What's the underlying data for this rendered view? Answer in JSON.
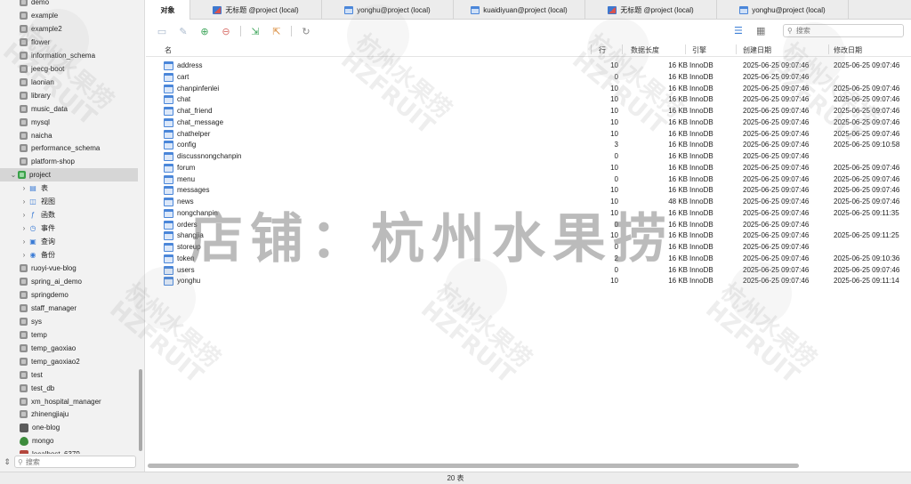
{
  "sidebar": {
    "items": [
      {
        "label": "demo",
        "kind": "db"
      },
      {
        "label": "example",
        "kind": "db"
      },
      {
        "label": "example2",
        "kind": "db"
      },
      {
        "label": "flower",
        "kind": "db"
      },
      {
        "label": "information_schema",
        "kind": "db"
      },
      {
        "label": "jeecg-boot",
        "kind": "db"
      },
      {
        "label": "laonian",
        "kind": "db"
      },
      {
        "label": "library",
        "kind": "db"
      },
      {
        "label": "music_data",
        "kind": "db"
      },
      {
        "label": "mysql",
        "kind": "db"
      },
      {
        "label": "naicha",
        "kind": "db"
      },
      {
        "label": "performance_schema",
        "kind": "db"
      },
      {
        "label": "platform-shop",
        "kind": "db"
      },
      {
        "label": "project",
        "kind": "db-open",
        "selected": true
      },
      {
        "label": "表",
        "kind": "obj",
        "icon": "table-icon"
      },
      {
        "label": "视图",
        "kind": "obj",
        "icon": "view-icon"
      },
      {
        "label": "函数",
        "kind": "obj",
        "icon": "function-icon"
      },
      {
        "label": "事件",
        "kind": "obj",
        "icon": "event-icon"
      },
      {
        "label": "查询",
        "kind": "obj",
        "icon": "query-icon"
      },
      {
        "label": "备份",
        "kind": "obj",
        "icon": "backup-icon"
      },
      {
        "label": "ruoyi-vue-blog",
        "kind": "db"
      },
      {
        "label": "spring_ai_demo",
        "kind": "db"
      },
      {
        "label": "springdemo",
        "kind": "db"
      },
      {
        "label": "staff_manager",
        "kind": "db"
      },
      {
        "label": "sys",
        "kind": "db"
      },
      {
        "label": "temp",
        "kind": "db"
      },
      {
        "label": "temp_gaoxiao",
        "kind": "db"
      },
      {
        "label": "temp_gaoxiao2",
        "kind": "db"
      },
      {
        "label": "test",
        "kind": "db"
      },
      {
        "label": "test_db",
        "kind": "db"
      },
      {
        "label": "xm_hospital_manager",
        "kind": "db"
      },
      {
        "label": "zhinengjiaju",
        "kind": "db"
      },
      {
        "label": "one-blog",
        "kind": "conn",
        "icon": "blog"
      },
      {
        "label": "mongo",
        "kind": "conn",
        "icon": "mongo"
      },
      {
        "label": "localhost_6379",
        "kind": "conn",
        "icon": "redis"
      }
    ],
    "search_placeholder": "搜索"
  },
  "tabs": [
    {
      "label": "对象",
      "active": true,
      "icon": ""
    },
    {
      "label": "无标题 @project (local)",
      "icon": "query"
    },
    {
      "label": "yonghu@project (local)",
      "icon": "table"
    },
    {
      "label": "kuaidiyuan@project (local)",
      "icon": "table"
    },
    {
      "label": "无标题 @project (local)",
      "icon": "query"
    },
    {
      "label": "yonghu@project (local)",
      "icon": "table"
    }
  ],
  "toolbar": {
    "search_placeholder": "搜索"
  },
  "table": {
    "columns": {
      "name": "名",
      "rows": "行",
      "size": "数据长度",
      "engine": "引擎",
      "created": "创建日期",
      "modified": "修改日期"
    },
    "rows": [
      {
        "name": "address",
        "rows": "10",
        "size": "16 KB",
        "engine": "InnoDB",
        "created": "2025-06-25 09:07:46",
        "modified": "2025-06-25 09:07:46"
      },
      {
        "name": "cart",
        "rows": "0",
        "size": "16 KB",
        "engine": "InnoDB",
        "created": "2025-06-25 09:07:46",
        "modified": ""
      },
      {
        "name": "chanpinfenlei",
        "rows": "10",
        "size": "16 KB",
        "engine": "InnoDB",
        "created": "2025-06-25 09:07:46",
        "modified": "2025-06-25 09:07:46"
      },
      {
        "name": "chat",
        "rows": "10",
        "size": "16 KB",
        "engine": "InnoDB",
        "created": "2025-06-25 09:07:46",
        "modified": "2025-06-25 09:07:46"
      },
      {
        "name": "chat_friend",
        "rows": "10",
        "size": "16 KB",
        "engine": "InnoDB",
        "created": "2025-06-25 09:07:46",
        "modified": "2025-06-25 09:07:46"
      },
      {
        "name": "chat_message",
        "rows": "10",
        "size": "16 KB",
        "engine": "InnoDB",
        "created": "2025-06-25 09:07:46",
        "modified": "2025-06-25 09:07:46"
      },
      {
        "name": "chathelper",
        "rows": "10",
        "size": "16 KB",
        "engine": "InnoDB",
        "created": "2025-06-25 09:07:46",
        "modified": "2025-06-25 09:07:46"
      },
      {
        "name": "config",
        "rows": "3",
        "size": "16 KB",
        "engine": "InnoDB",
        "created": "2025-06-25 09:07:46",
        "modified": "2025-06-25 09:10:58"
      },
      {
        "name": "discussnongchanpin",
        "rows": "0",
        "size": "16 KB",
        "engine": "InnoDB",
        "created": "2025-06-25 09:07:46",
        "modified": ""
      },
      {
        "name": "forum",
        "rows": "10",
        "size": "16 KB",
        "engine": "InnoDB",
        "created": "2025-06-25 09:07:46",
        "modified": "2025-06-25 09:07:46"
      },
      {
        "name": "menu",
        "rows": "0",
        "size": "16 KB",
        "engine": "InnoDB",
        "created": "2025-06-25 09:07:46",
        "modified": "2025-06-25 09:07:46"
      },
      {
        "name": "messages",
        "rows": "10",
        "size": "16 KB",
        "engine": "InnoDB",
        "created": "2025-06-25 09:07:46",
        "modified": "2025-06-25 09:07:46"
      },
      {
        "name": "news",
        "rows": "10",
        "size": "48 KB",
        "engine": "InnoDB",
        "created": "2025-06-25 09:07:46",
        "modified": "2025-06-25 09:07:46"
      },
      {
        "name": "nongchanpin",
        "rows": "10",
        "size": "16 KB",
        "engine": "InnoDB",
        "created": "2025-06-25 09:07:46",
        "modified": "2025-06-25 09:11:35"
      },
      {
        "name": "orders",
        "rows": "0",
        "size": "16 KB",
        "engine": "InnoDB",
        "created": "2025-06-25 09:07:46",
        "modified": ""
      },
      {
        "name": "shangjia",
        "rows": "10",
        "size": "16 KB",
        "engine": "InnoDB",
        "created": "2025-06-25 09:07:46",
        "modified": "2025-06-25 09:11:25"
      },
      {
        "name": "storeup",
        "rows": "0",
        "size": "16 KB",
        "engine": "InnoDB",
        "created": "2025-06-25 09:07:46",
        "modified": ""
      },
      {
        "name": "token",
        "rows": "2",
        "size": "16 KB",
        "engine": "InnoDB",
        "created": "2025-06-25 09:07:46",
        "modified": "2025-06-25 09:10:36"
      },
      {
        "name": "users",
        "rows": "0",
        "size": "16 KB",
        "engine": "InnoDB",
        "created": "2025-06-25 09:07:46",
        "modified": "2025-06-25 09:07:46"
      },
      {
        "name": "yonghu",
        "rows": "10",
        "size": "16 KB",
        "engine": "InnoDB",
        "created": "2025-06-25 09:07:46",
        "modified": "2025-06-25 09:11:14"
      }
    ]
  },
  "status": {
    "count": "20 表"
  },
  "watermark": {
    "main": "店铺：杭州水果捞",
    "stamp_cn": "杭州水果捞",
    "stamp_en": "HZFRUIT"
  }
}
